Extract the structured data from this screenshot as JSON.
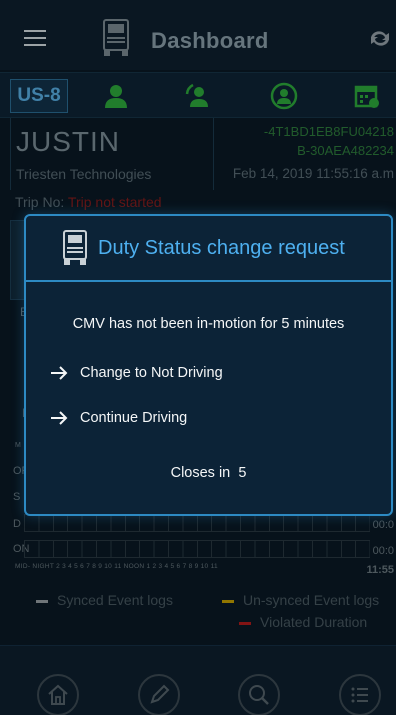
{
  "header": {
    "title": "Dashboard"
  },
  "unit_tab": {
    "label": "US-8"
  },
  "driver": {
    "name": "JUSTIN",
    "company": "Triesten Technologies",
    "vin_line1": "-4T1BD1EB8FU04218",
    "vin_line2": "B-30AEA482234",
    "datetime": "Feb 14, 2019 11:55:16 a.m"
  },
  "trip": {
    "label": "Trip No:",
    "value": "Trip not started"
  },
  "graph": {
    "rows": [
      {
        "label": "OF",
        "time": ""
      },
      {
        "label": "S",
        "time": ""
      },
      {
        "label": "D",
        "time": "00:0"
      },
      {
        "label": "ON",
        "time": "00:0"
      }
    ],
    "hour_scale": "MID- NIGHT  2   3   4   5   6   7   8   9  10  11 NOON 1   2   3   4   5   6   7   8   9  10  11",
    "scale_end": "11:55",
    "bg_letters": [
      "E",
      "I",
      "M"
    ]
  },
  "legend": {
    "synced": "Synced Event logs",
    "unsynced": "Un-synced Event logs",
    "violated": "Violated Duration",
    "colors": {
      "synced": "#9aa3a8",
      "unsynced": "#c9a400",
      "violated": "#b51c1c"
    }
  },
  "modal": {
    "title": "Duty Status change request",
    "message": "CMV has not been in-motion for 5 minutes",
    "option1": "Change to Not Driving",
    "option2": "Continue Driving",
    "closes_label": "Closes in",
    "closes_value": "5"
  },
  "icons": {
    "menu": "hamburger-icon",
    "logo": "truck-icon",
    "sync": "sync-icon",
    "row": [
      "driver-icon",
      "driver-swap-icon",
      "co-driver-icon",
      "calendar-icon"
    ],
    "nav": [
      "home-icon",
      "edit-icon",
      "search-icon",
      "list-icon"
    ]
  },
  "colors": {
    "accent": "#2d8ac3",
    "title_blue": "#4eb0f0",
    "green": "#2fae3d"
  }
}
